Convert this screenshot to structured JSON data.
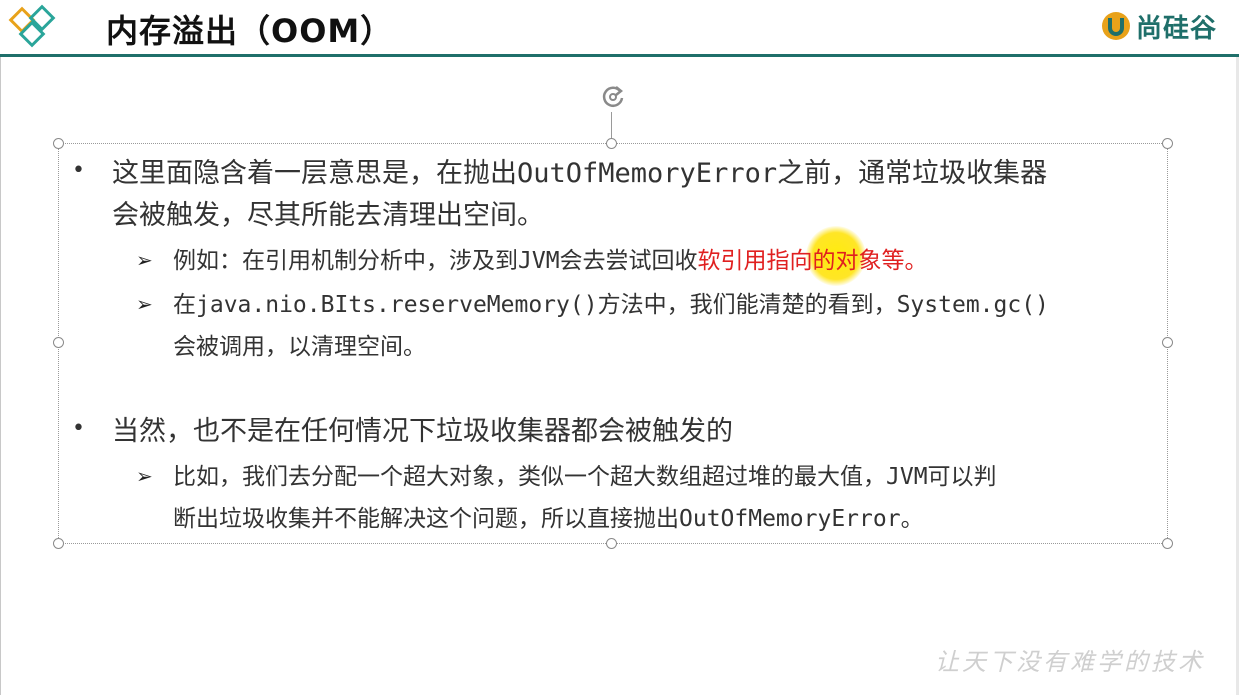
{
  "header": {
    "title": "内存溢出（OOM）",
    "brand": "尚硅谷"
  },
  "bullets": [
    {
      "text_1": "这里面隐含着一层意思是，在抛出",
      "text_mono": "OutOfMemoryError",
      "text_2": "之前，通常垃圾收集器",
      "line2": "会被触发，尽其所能去清理出空间。",
      "subs": [
        {
          "part_1": "例如：在引用机制分析中，涉及到",
          "part_mono": "JVM",
          "part_2": "会去尝试回收",
          "part_red": "软引用指向的对象等。"
        },
        {
          "part_1": "在",
          "part_mono": "java.nio.BIts.reserveMemory()",
          "part_2": "方法中，我们能清楚的看到，",
          "part_mono2": "System.gc()",
          "line2": "会被调用，以清理空间。"
        }
      ]
    },
    {
      "text": "当然，也不是在任何情况下垃圾收集器都会被触发的",
      "subs": [
        {
          "part_1": "比如，我们去分配一个超大对象，类似一个超大数组超过堆的最大值，",
          "part_mono": "JVM",
          "part_2": "可以判",
          "line2_1": "断出垃圾收集并不能解决这个问题，所以直接抛出",
          "line2_mono": "OutOfMemoryError",
          "line2_2": "。"
        }
      ]
    }
  ],
  "watermark": "让天下没有难学的技术",
  "colors": {
    "accent": "#1f6f6a",
    "highlight_red": "#e02020",
    "cursor_yellow": "#ffe600"
  }
}
